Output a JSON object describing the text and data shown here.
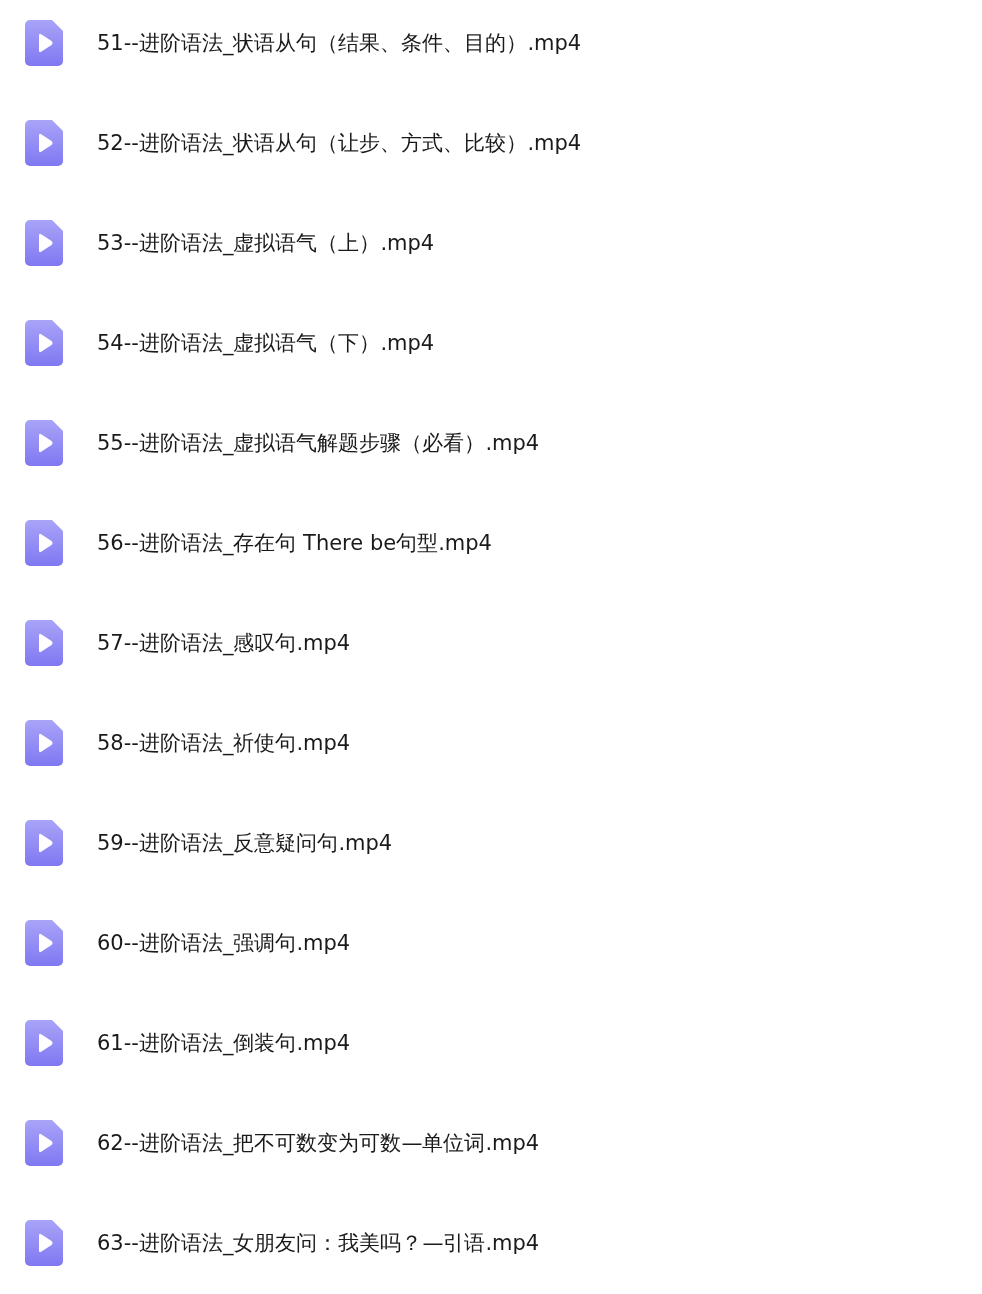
{
  "files": [
    {
      "name": "51--进阶语法_状语从句（结果、条件、目的）.mp4"
    },
    {
      "name": "52--进阶语法_状语从句（让步、方式、比较）.mp4"
    },
    {
      "name": "53--进阶语法_虚拟语气（上）.mp4"
    },
    {
      "name": "54--进阶语法_虚拟语气（下）.mp4"
    },
    {
      "name": "55--进阶语法_虚拟语气解题步骤（必看）.mp4"
    },
    {
      "name": "56--进阶语法_存在句 There be句型.mp4"
    },
    {
      "name": "57--进阶语法_感叹句.mp4"
    },
    {
      "name": "58--进阶语法_祈使句.mp4"
    },
    {
      "name": "59--进阶语法_反意疑问句.mp4"
    },
    {
      "name": "60--进阶语法_强调句.mp4"
    },
    {
      "name": "61--进阶语法_倒装句.mp4"
    },
    {
      "name": "62--进阶语法_把不可数变为可数—单位词.mp4"
    },
    {
      "name": "63--进阶语法_女朋友问：我美吗？—引语.mp4"
    }
  ]
}
